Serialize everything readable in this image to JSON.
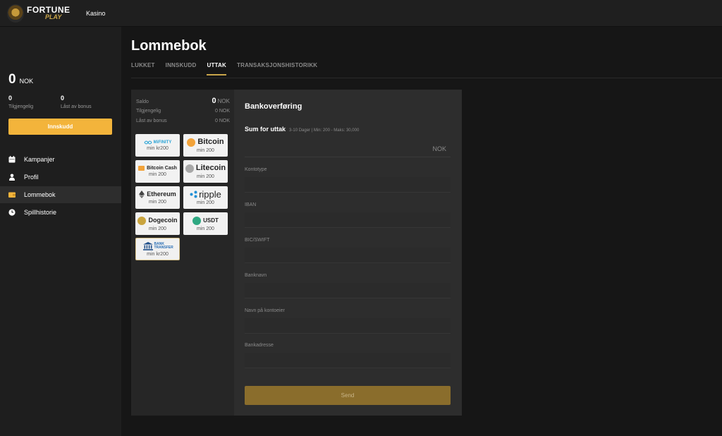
{
  "header": {
    "logo_word1": "FORTUNE",
    "logo_word2": "PLAY",
    "nav_link": "Kasino"
  },
  "sidebar": {
    "balance": "0",
    "currency": "NOK",
    "available_value": "0",
    "available_label": "Tilgjengelig",
    "bonus_value": "0",
    "bonus_label": "Låst av bonus",
    "deposit_label": "Innskudd",
    "items": [
      {
        "label": "Kampanjer",
        "icon": "calendar-icon"
      },
      {
        "label": "Profil",
        "icon": "user-icon"
      },
      {
        "label": "Lommebok",
        "icon": "wallet-icon",
        "active": true
      },
      {
        "label": "Spillhistorie",
        "icon": "clock-icon"
      }
    ]
  },
  "page": {
    "title": "Lommebok",
    "tabs": [
      {
        "label": "LUKKET"
      },
      {
        "label": "INNSKUDD"
      },
      {
        "label": "UTTAK",
        "active": true
      },
      {
        "label": "TRANSAKSJONSHISTORIKK"
      }
    ]
  },
  "summary": {
    "saldo_label": "Saldo",
    "saldo_value": "0",
    "saldo_unit": "NOK",
    "available_label": "Tilgjengelig",
    "available_value": "0 NOK",
    "bonus_label": "Låst av bonus",
    "bonus_value": "0 NOK"
  },
  "methods": [
    {
      "name": "MiFINITY",
      "min": "min kr200",
      "icon": "mifinity-icon",
      "color": "#2aa3d6"
    },
    {
      "name": "Bitcoin",
      "min": "min 200",
      "icon": "bitcoin-icon",
      "color": "#f2a33a"
    },
    {
      "name": "Bitcoin Cash",
      "min": "min 200",
      "icon": "bitcoin-cash-icon",
      "color": "#f2a33a"
    },
    {
      "name": "Litecoin",
      "min": "min 200",
      "icon": "litecoin-icon",
      "color": "#a8a8a8"
    },
    {
      "name": "Ethereum",
      "min": "min 200",
      "icon": "ethereum-icon",
      "color": "#444444"
    },
    {
      "name": "ripple",
      "min": "min 200",
      "icon": "ripple-icon",
      "color": "#1e8fd6"
    },
    {
      "name": "Dogecoin",
      "min": "min 200",
      "icon": "dogecoin-icon",
      "color": "#c9a43e"
    },
    {
      "name": "USDT",
      "min": "min 200",
      "icon": "tether-icon",
      "color": "#2fa882"
    },
    {
      "name": "BANK TRANSFER",
      "min": "min kr200",
      "icon": "bank-icon",
      "color": "#2a6fb5"
    }
  ],
  "form": {
    "title": "Bankoverføring",
    "sum_label": "Sum for uttak",
    "sum_hint": "3-10 Dager | Min: 200 - Maks: 30,000",
    "amount_unit": "NOK",
    "fields": [
      {
        "label": "Kontotype"
      },
      {
        "label": "IBAN"
      },
      {
        "label": "BIC/SWIFT"
      },
      {
        "label": "Banknavn"
      },
      {
        "label": "Navn på kontoeier"
      },
      {
        "label": "Bankadresse"
      }
    ],
    "submit_label": "Send"
  },
  "colors": {
    "accent": "#f3b43b",
    "gold": "#c9a54a",
    "submit": "#8a6d2c"
  }
}
